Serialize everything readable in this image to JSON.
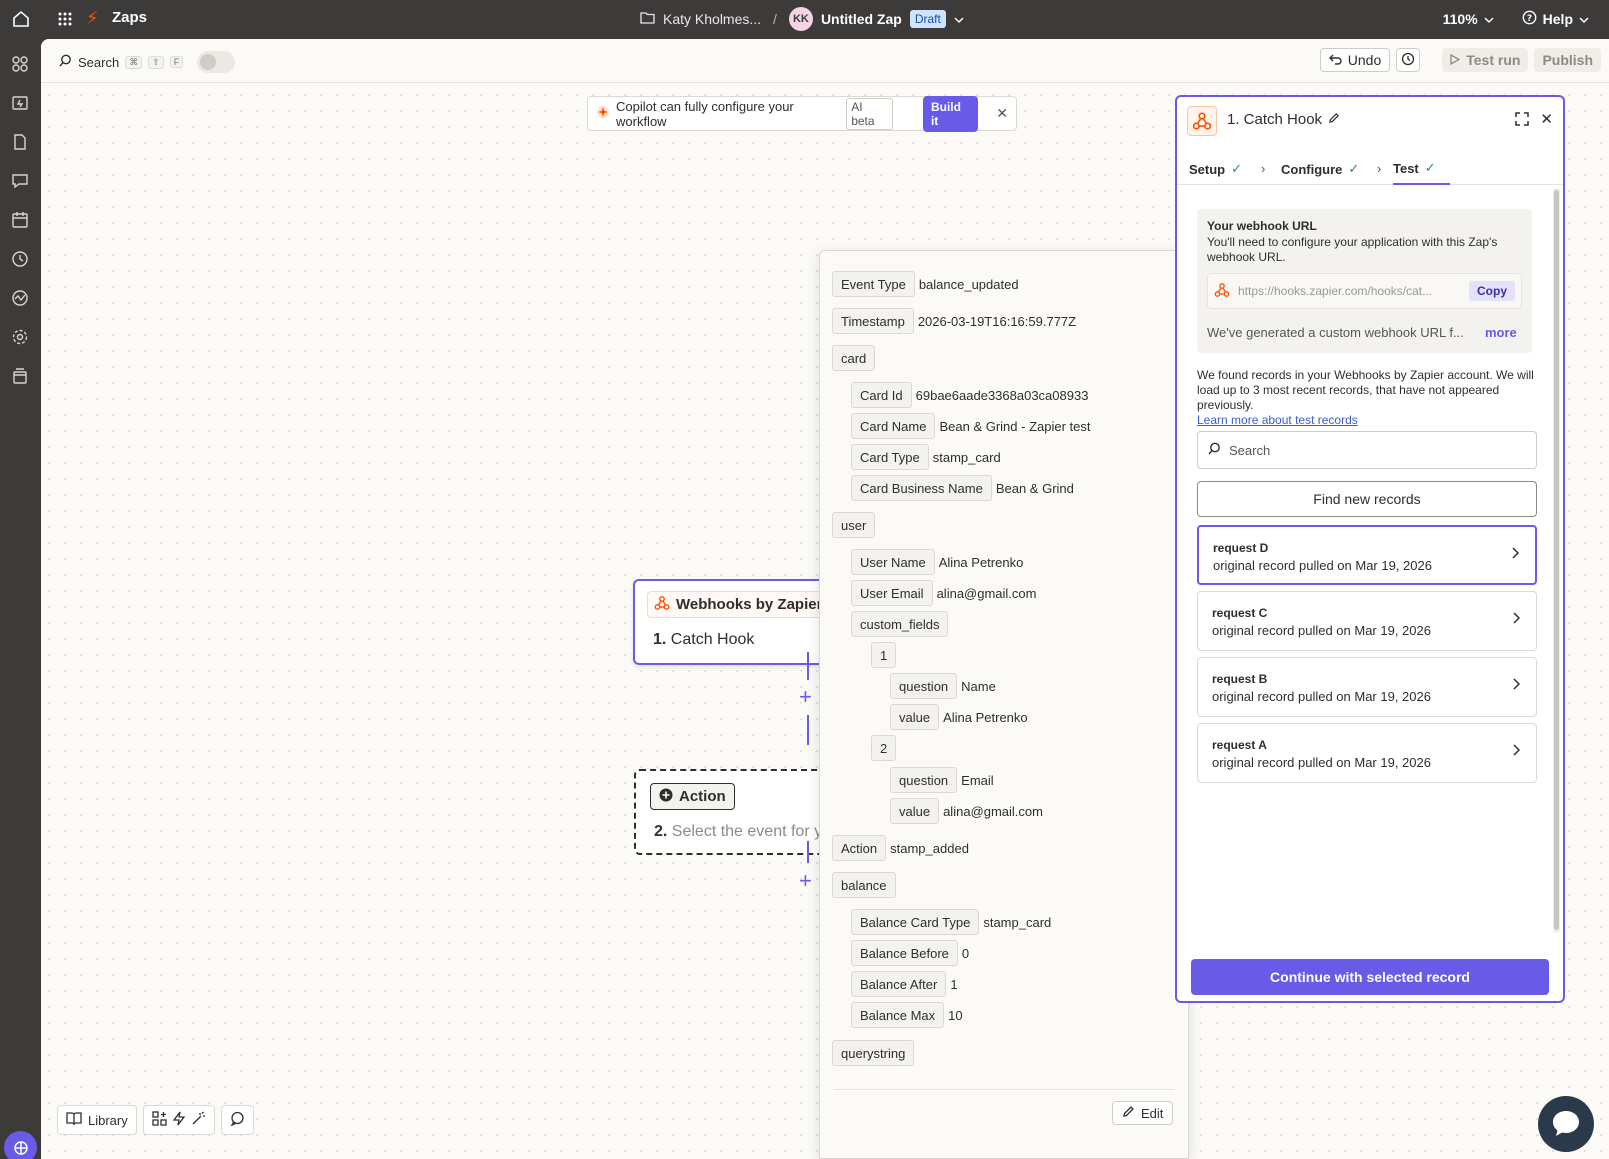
{
  "topbar": {
    "app_name": "Zaps",
    "folder_name": "Katy Kholmes...",
    "separator": "/",
    "owner_initials": "KK",
    "zap_title": "Untitled Zap",
    "status_badge": "Draft",
    "zoom": "110%",
    "help_label": "Help"
  },
  "sidebar": {
    "items": [
      "zaps-icon",
      "transfers-icon",
      "tables-icon",
      "interfaces-icon",
      "canvas-icon",
      "history-icon",
      "activity-icon",
      "settings-icon",
      "archive-icon"
    ]
  },
  "toolbar": {
    "search_label": "Search",
    "shortcut_keys": [
      "⌘",
      "⇧",
      "F"
    ],
    "undo_label": "Undo",
    "test_run_label": "Test run",
    "publish_label": "Publish"
  },
  "copilot": {
    "message": "Copilot can fully configure your workflow",
    "badge": "AI beta",
    "build_label": "Build it"
  },
  "nodes": {
    "trigger": {
      "app": "Webhooks by Zapier",
      "number": "1.",
      "name": "Catch Hook"
    },
    "action": {
      "label": "Action",
      "number": "2.",
      "name": "Select the event for y"
    }
  },
  "record_data": {
    "event_type": {
      "key": "Event Type",
      "value": "balance_updated"
    },
    "timestamp": {
      "key": "Timestamp",
      "value": "2026-03-19T16:16:59.777Z"
    },
    "card": {
      "key": "card",
      "card_id": {
        "key": "Card Id",
        "value": "69bae6aade3368a03ca08933"
      },
      "card_name": {
        "key": "Card Name",
        "value": "Bean & Grind - Zapier test"
      },
      "card_type": {
        "key": "Card Type",
        "value": "stamp_card"
      },
      "business_name": {
        "key": "Card Business Name",
        "value": "Bean & Grind"
      }
    },
    "user": {
      "key": "user",
      "user_name": {
        "key": "User Name",
        "value": "Alina Petrenko"
      },
      "user_email": {
        "key": "User Email",
        "value": "alina@gmail.com"
      },
      "custom_fields": {
        "key": "custom_fields",
        "item1": {
          "key": "1",
          "question": {
            "key": "question",
            "value": "Name"
          },
          "value": {
            "key": "value",
            "value": "Alina Petrenko"
          }
        },
        "item2": {
          "key": "2",
          "question": {
            "key": "question",
            "value": "Email"
          },
          "value": {
            "key": "value",
            "value": "alina@gmail.com"
          }
        }
      }
    },
    "action": {
      "key": "Action",
      "value": "stamp_added"
    },
    "balance": {
      "key": "balance",
      "card_type": {
        "key": "Balance Card Type",
        "value": "stamp_card"
      },
      "before": {
        "key": "Balance Before",
        "value": "0"
      },
      "after": {
        "key": "Balance After",
        "value": "1"
      },
      "max": {
        "key": "Balance Max",
        "value": "10"
      }
    },
    "querystring": {
      "key": "querystring"
    },
    "edit_label": "Edit"
  },
  "panel": {
    "title": "1. Catch Hook",
    "tabs": [
      {
        "label": "Setup"
      },
      {
        "label": "Configure"
      },
      {
        "label": "Test"
      }
    ],
    "webhook": {
      "title": "Your webhook URL",
      "description": "You'll need to configure your application with this Zap's webhook URL.",
      "url": "https://hooks.zapier.com/hooks/cat...",
      "copy_label": "Copy",
      "note": "We've generated a custom webhook URL f...",
      "more_label": "more"
    },
    "found_text": "We found records in your Webhooks by Zapier account. We will load up to 3 most recent records, that have not appeared previously.",
    "learn_more": "Learn more about test records",
    "search_placeholder": "Search",
    "find_label": "Find new records",
    "records": [
      {
        "name": "request D",
        "sub": "original record pulled on Mar 19, 2026"
      },
      {
        "name": "request C",
        "sub": "original record pulled on Mar 19, 2026"
      },
      {
        "name": "request B",
        "sub": "original record pulled on Mar 19, 2026"
      },
      {
        "name": "request A",
        "sub": "original record pulled on Mar 19, 2026"
      }
    ],
    "continue_label": "Continue with selected record"
  },
  "bottom_bar": {
    "library_label": "Library"
  },
  "colors": {
    "accent": "#695be8",
    "topbar": "#3d3a3a",
    "brand": "#ff4f00"
  }
}
